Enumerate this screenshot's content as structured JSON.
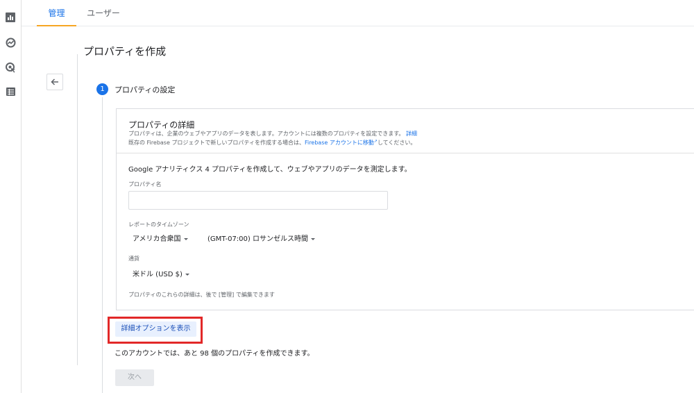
{
  "tabs": [
    {
      "label": "管理",
      "active": true
    },
    {
      "label": "ユーザー",
      "active": false
    }
  ],
  "rail_icons": [
    "bar-chart-icon",
    "explore-icon",
    "targeting-icon",
    "list-icon"
  ],
  "page_title": "プロパティを作成",
  "step": {
    "number": "1",
    "label": "プロパティの設定"
  },
  "card": {
    "title": "プロパティの詳細",
    "desc1": "プロパティは、企業のウェブやアプリのデータを表します。アカウントには複数のプロパティを設定できます。",
    "desc1_link": "詳細",
    "desc2_pre": "既存の Firebase プロジェクトで新しいプロパティを作成する場合は、",
    "desc2_link": "Firebase アカウントに移動",
    "desc2_post": "してください。",
    "intro": "Google アナリティクス 4 プロパティを作成して、ウェブやアプリのデータを測定します。",
    "property_name_label": "プロパティ名",
    "property_name_value": "",
    "timezone_label": "レポートのタイムゾーン",
    "country_value": "アメリカ合衆国",
    "timezone_value": "(GMT-07:00) ロサンゼルス時間",
    "currency_label": "通貨",
    "currency_value": "米ドル (USD $)",
    "note": "プロパティのこれらの詳細は、後で [管理] で編集できます"
  },
  "advanced_button": "詳細オプションを表示",
  "quota_text": "このアカウントでは、あと 98 個のプロパティを作成できます。",
  "next_button": "次へ",
  "colors": {
    "accent": "#1a73e8",
    "tab_indicator": "#f6a623",
    "highlight": "#e22828"
  }
}
